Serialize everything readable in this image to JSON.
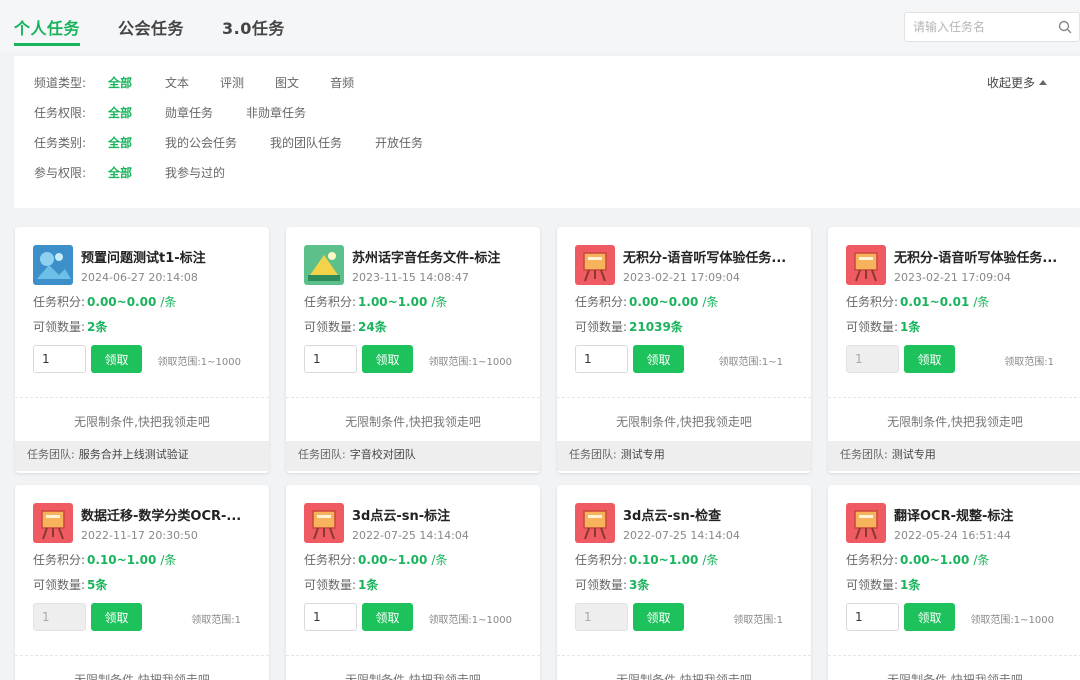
{
  "tabs": [
    {
      "label": "个人任务",
      "active": true
    },
    {
      "label": "公会任务",
      "active": false
    },
    {
      "label": "3.0任务",
      "active": false
    }
  ],
  "search": {
    "placeholder": "请输入任务名"
  },
  "filters": {
    "collapse_label": "收起更多",
    "rows": [
      {
        "label": "频道类型:",
        "options": [
          "全部",
          "文本",
          "评测",
          "图文",
          "音频"
        ],
        "active": 0
      },
      {
        "label": "任务权限:",
        "options": [
          "全部",
          "勋章任务",
          "非勋章任务"
        ],
        "active": 0
      },
      {
        "label": "任务类别:",
        "options": [
          "全部",
          "我的公会任务",
          "我的团队任务",
          "开放任务"
        ],
        "active": 0
      },
      {
        "label": "参与权限:",
        "options": [
          "全部",
          "我参与过的"
        ],
        "active": 0
      }
    ]
  },
  "labels": {
    "points": "任务积分:",
    "quantity": "可领数量:",
    "claim": "领取",
    "unit": "/条",
    "team": "任务团队:",
    "condition": "无限制条件,快把我领走吧"
  },
  "cards": [
    {
      "title": "预置问题测试t1-标注",
      "date": "2024-06-27 20:14:08",
      "points": "0.00~0.00",
      "quantity": "2条",
      "input": "1",
      "disabled": false,
      "range": "领取范围:1~1000",
      "team": "服务合并上线测试验证",
      "icon": "photo-icon"
    },
    {
      "title": "苏州话字音任务文件-标注",
      "date": "2023-11-15 14:08:47",
      "points": "1.00~1.00",
      "quantity": "24条",
      "input": "1",
      "disabled": false,
      "range": "领取范围:1~1000",
      "team": "字音校对团队",
      "icon": "landscape-icon"
    },
    {
      "title": "无积分-语音听写体验任务...",
      "date": "2023-02-21 17:09:04",
      "points": "0.00~0.00",
      "quantity": "21039条",
      "input": "1",
      "disabled": false,
      "range": "领取范围:1~1",
      "team": "测试专用",
      "icon": "easel-icon"
    },
    {
      "title": "无积分-语音听写体验任务...",
      "date": "2023-02-21 17:09:04",
      "points": "0.01~0.01",
      "quantity": "1条",
      "input": "1",
      "disabled": true,
      "range": "领取范围:1",
      "team": "测试专用",
      "icon": "easel-icon"
    },
    {
      "title": "数据迁移-数学分类OCR-...",
      "date": "2022-11-17 20:30:50",
      "points": "0.10~1.00",
      "quantity": "5条",
      "input": "1",
      "disabled": true,
      "range": "领取范围:1",
      "team": "",
      "icon": "easel-icon"
    },
    {
      "title": "3d点云-sn-标注",
      "date": "2022-07-25 14:14:04",
      "points": "0.00~1.00",
      "quantity": "1条",
      "input": "1",
      "disabled": false,
      "range": "领取范围:1~1000",
      "team": "",
      "icon": "easel-icon"
    },
    {
      "title": "3d点云-sn-检查",
      "date": "2022-07-25 14:14:04",
      "points": "0.10~1.00",
      "quantity": "3条",
      "input": "1",
      "disabled": true,
      "range": "领取范围:1",
      "team": "",
      "icon": "easel-icon"
    },
    {
      "title": "翻译OCR-规整-标注",
      "date": "2022-05-24 16:51:44",
      "points": "0.00~1.00",
      "quantity": "1条",
      "input": "1",
      "disabled": false,
      "range": "领取范围:1~1000",
      "team": "",
      "icon": "easel-icon"
    }
  ],
  "colors": {
    "accent": "#19b35c",
    "button": "#1ec25c"
  }
}
